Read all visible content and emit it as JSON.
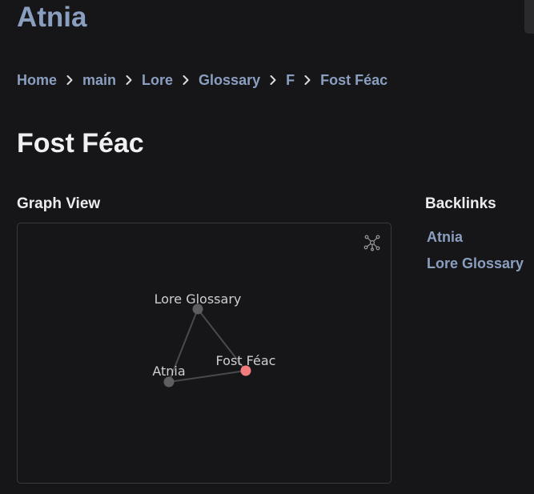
{
  "site": {
    "title": "Atnia"
  },
  "breadcrumb": {
    "items": [
      "Home",
      "main",
      "Lore",
      "Glossary",
      "F",
      "Fost Féac"
    ],
    "separator_icon": "chevron-right-icon"
  },
  "page": {
    "title": "Fost Féac"
  },
  "graph": {
    "heading": "Graph View",
    "global_graph_icon": "global-graph-icon",
    "nodes": [
      {
        "id": "lore-glossary",
        "label": "Lore Glossary",
        "current": false
      },
      {
        "id": "atnia",
        "label": "Atnia",
        "current": false
      },
      {
        "id": "fost-feac",
        "label": "Fost Féac",
        "current": true
      }
    ],
    "edges": [
      [
        "lore-glossary",
        "atnia"
      ],
      [
        "lore-glossary",
        "fost-feac"
      ],
      [
        "atnia",
        "fost-feac"
      ]
    ],
    "colors": {
      "node": "#5e5e62",
      "current_node": "#f27c7c",
      "edge": "#4a4a4e",
      "label": "#cfcfd3"
    }
  },
  "backlinks": {
    "heading": "Backlinks",
    "items": [
      "Atnia",
      "Lore Glossary"
    ]
  },
  "colors": {
    "background": "#161618",
    "accent": "#8a9fc0",
    "heading": "#ececee"
  }
}
